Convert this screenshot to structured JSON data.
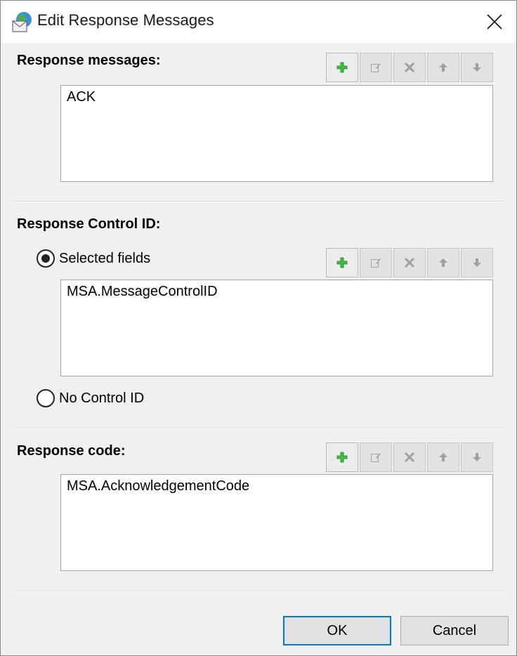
{
  "window": {
    "title": "Edit Response Messages",
    "app_icon": "envelope-globe-icon",
    "close_icon": "close-icon"
  },
  "toolbar_icons": [
    "add-icon",
    "edit-icon",
    "delete-icon",
    "move-up-icon",
    "move-down-icon"
  ],
  "toolbar_state": [
    "enabled",
    "disabled",
    "disabled",
    "disabled",
    "disabled"
  ],
  "response_messages": {
    "label": "Response messages:",
    "items": [
      "ACK"
    ]
  },
  "response_control_id": {
    "label": "Response Control ID:",
    "selected_fields_label": "Selected fields",
    "selected_fields_checked": true,
    "items": [
      "MSA.MessageControlID"
    ],
    "no_control_id_label": "No Control ID",
    "no_control_id_checked": false
  },
  "response_code": {
    "label": "Response code:",
    "items": [
      "MSA.AcknowledgementCode"
    ]
  },
  "buttons": {
    "ok": "OK",
    "cancel": "Cancel"
  },
  "colors": {
    "add_green": "#3cc23c",
    "focus_blue": "#0078d7",
    "disabled_gray": "#a0a0a0"
  }
}
